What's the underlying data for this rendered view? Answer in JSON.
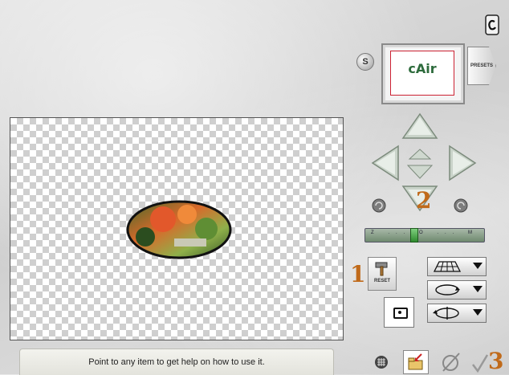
{
  "preview": {
    "thumbnail_text": "cAir",
    "preset_label": "PRESETS"
  },
  "controls": {
    "s_button_label": "S",
    "reset_label": "RESET"
  },
  "steps": {
    "step1": "1",
    "step2": "2",
    "step3": "3"
  },
  "zoom": {
    "ticks": "Z ... O ... M"
  },
  "status": {
    "help_text": "Point to any item to get help on how to use it."
  },
  "colors": {
    "accent_orange": "#c06a1a",
    "canvas_checker": "#cfcfcf",
    "slider_green": "#2e8a2e"
  },
  "icons": {
    "logo": "e-logo-icon",
    "grid": "grid-icon",
    "open": "open-folder-icon",
    "cancel": "cancel-icon",
    "ok": "checkmark-icon"
  }
}
